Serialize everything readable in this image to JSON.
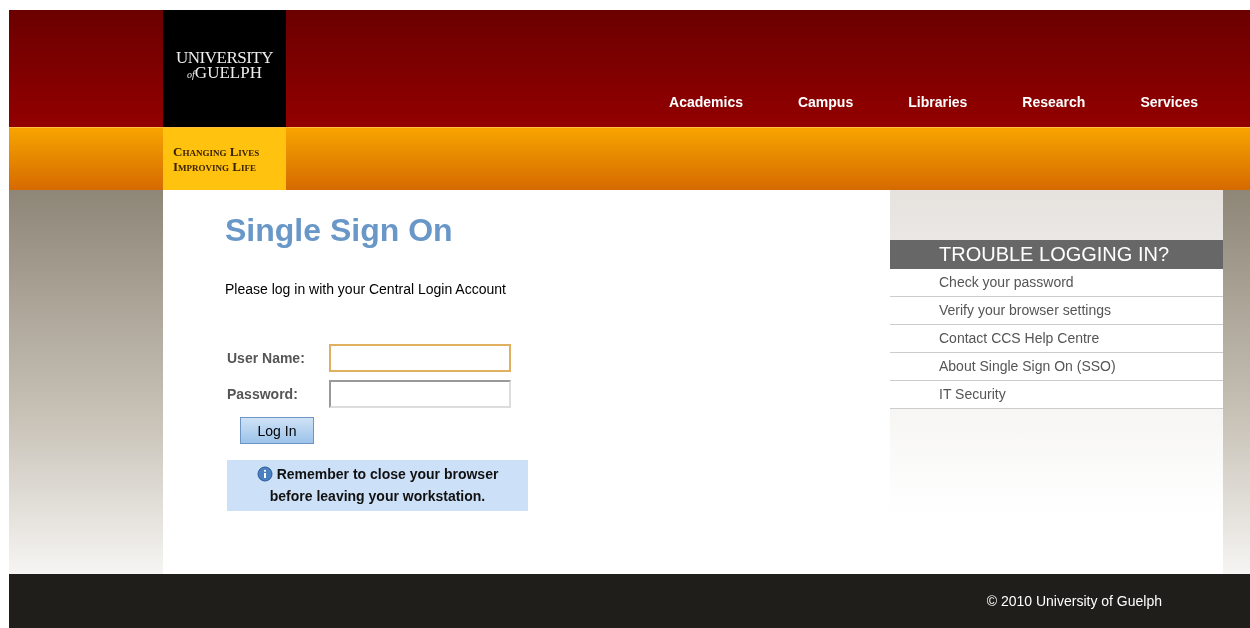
{
  "logo": {
    "line_1": "UNIVERSITY",
    "line_2_prefix": "of",
    "line_2": "GUELPH"
  },
  "tagline": [
    "Changing Lives",
    "Improving Life"
  ],
  "nav": [
    {
      "label": "Academics"
    },
    {
      "label": "Campus"
    },
    {
      "label": "Libraries"
    },
    {
      "label": "Research"
    },
    {
      "label": "Services"
    }
  ],
  "title": "Single Sign On",
  "intro": "Please log in with your Central Login Account",
  "fields": [
    {
      "label": "User Name:",
      "focused": true
    },
    {
      "label": "Password:",
      "focused": false
    }
  ],
  "login_button": "Log In",
  "notice": {
    "line_1": "Remember to close your browser",
    "line_2": "before leaving your workstation."
  },
  "sidebar": {
    "heading": "TROUBLE LOGGING IN?",
    "links": [
      "Check your password",
      "Verify your browser settings",
      "Contact CCS Help Centre",
      "About Single Sign On (SSO)",
      "IT Security"
    ]
  },
  "footer": "© 2010 University of Guelph"
}
